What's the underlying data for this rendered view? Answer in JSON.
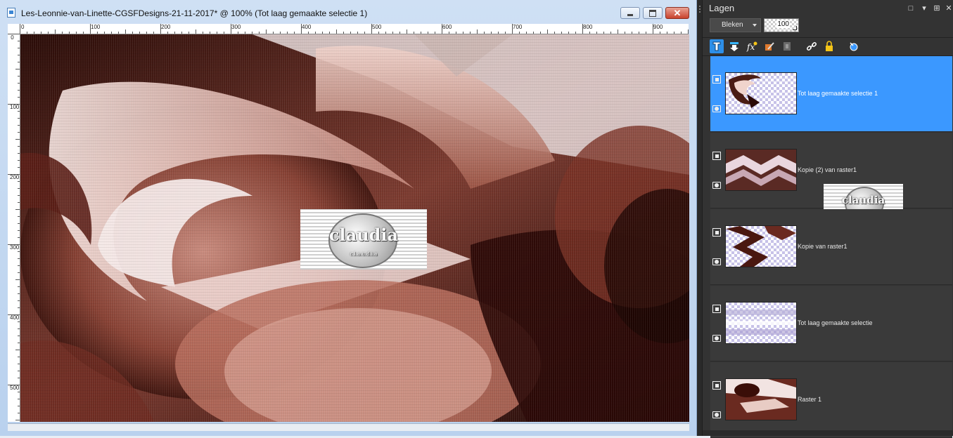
{
  "document": {
    "title": "Les-Leonnie-van-Linette-CGSFDesigns-21-11-2017* @ 100% (Tot laag gemaakte selectie 1)",
    "ruler_top_labels": [
      "0",
      "100",
      "200",
      "300",
      "400",
      "500",
      "600",
      "700",
      "800",
      "900"
    ],
    "ruler_left_labels": [
      "0",
      "100",
      "200",
      "300",
      "400",
      "500"
    ],
    "window_buttons": {
      "minimize": "minimize",
      "maximize": "maximize",
      "close": "✕"
    }
  },
  "watermark": {
    "main": "claudia",
    "small": "c.l.a.u.d.i.a"
  },
  "layers_panel": {
    "title": "Lagen",
    "blend_mode": "Bleken",
    "opacity": "100",
    "toolbar_icons": [
      "new-raster-layer-icon",
      "new-vector-layer-icon",
      "layer-effects-icon",
      "layer-properties-icon",
      "mask-icon",
      "link-icon",
      "lock-icon",
      "adjustment-layer-icon"
    ],
    "layers": [
      {
        "name": "Tot laag gemaakte selectie 1",
        "selected": true
      },
      {
        "name": "Kopie (2) van raster1",
        "selected": false
      },
      {
        "name": "Kopie van raster1",
        "selected": false
      },
      {
        "name": "Tot laag gemaakte selectie",
        "selected": false
      },
      {
        "name": "Raster 1",
        "selected": false
      }
    ]
  },
  "colors": {
    "canvas_dark": "#3a1410",
    "canvas_mid": "#8a4a3e",
    "canvas_light": "#f3dcd6",
    "panel_bg": "#333333",
    "selection": "#3b98ff"
  }
}
